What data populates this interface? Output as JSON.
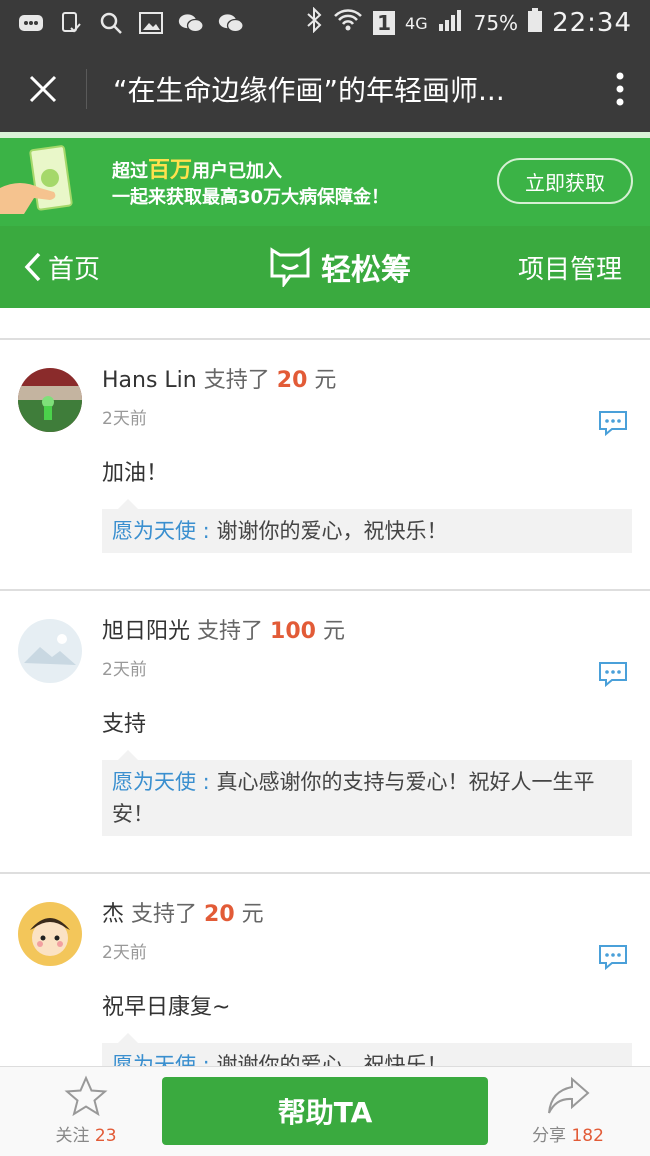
{
  "status_bar": {
    "battery": "75%",
    "time": "22:34",
    "network": "4G",
    "sim": "1"
  },
  "titlebar": {
    "title": "“在生命边缘作画”的年轻画师..."
  },
  "banner": {
    "line1_prefix": "超过",
    "line1_highlight": "百万",
    "line1_suffix": "用户已加入",
    "line2": "一起来获取最高30万大病保障金！",
    "cta": "立即获取"
  },
  "navbar": {
    "back_label": "首页",
    "logo_text": "轻松筹",
    "manage_label": "项目管理"
  },
  "donations": [
    {
      "name": "Hans Lin",
      "action": "支持了",
      "amount": "20",
      "unit": "元",
      "time": "2天前",
      "message": "加油！",
      "reply_who": "愿为天使 :",
      "reply_text": " 谢谢你的爱心，祝快乐！"
    },
    {
      "name": "旭日阳光",
      "action": "支持了",
      "amount": "100",
      "unit": "元",
      "time": "2天前",
      "message": "支持",
      "reply_who": "愿为天使 :",
      "reply_text": " 真心感谢你的支持与爱心！祝好人一生平安！"
    },
    {
      "name": "杰",
      "action": "支持了",
      "amount": "20",
      "unit": "元",
      "time": "2天前",
      "message": "祝早日康复~",
      "reply_who": "愿为天使 :",
      "reply_text": " 谢谢你的爱心，祝快乐！"
    }
  ],
  "bottom": {
    "follow_label": "关注",
    "follow_count": "23",
    "help_label": "帮助TA",
    "share_label": "分享",
    "share_count": "182"
  },
  "colors": {
    "green": "#3aaa3f",
    "amount": "#e25b37",
    "reply_name": "#3a8fcf"
  }
}
